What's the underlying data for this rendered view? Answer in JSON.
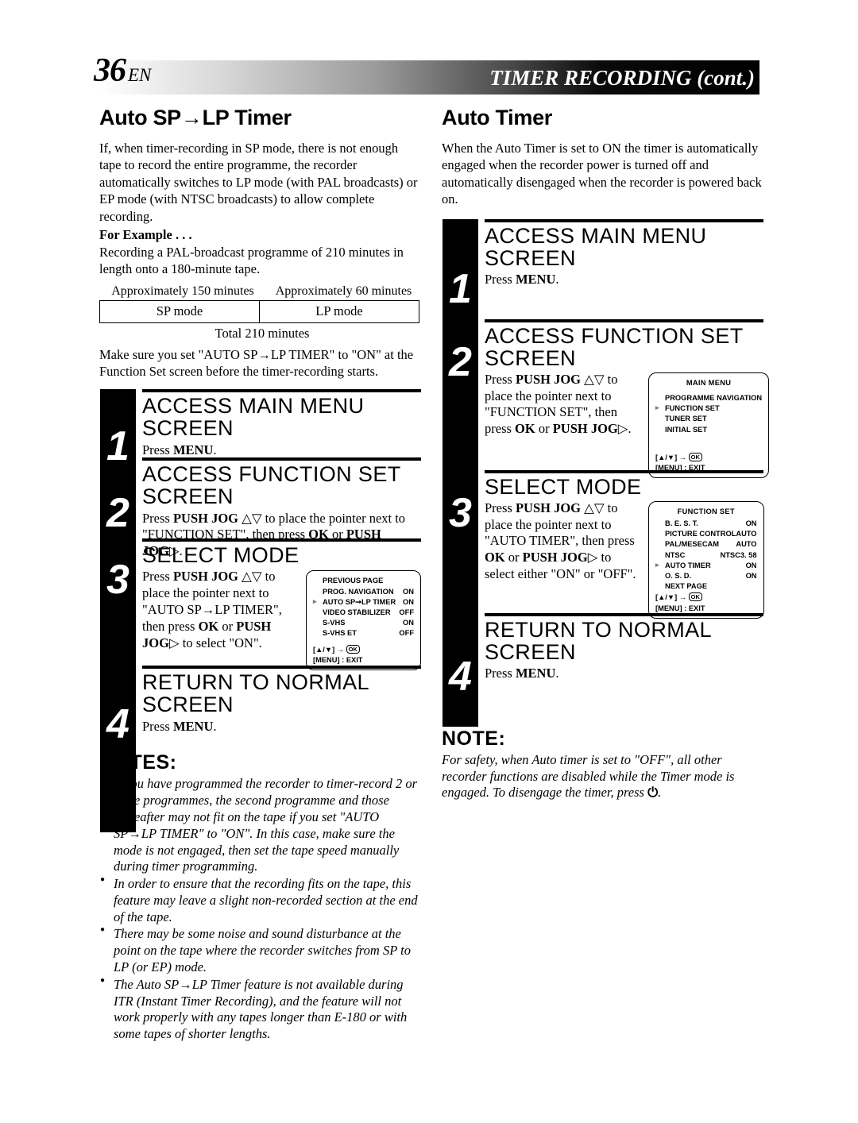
{
  "header": {
    "page_number": "36",
    "page_lang": "EN",
    "title": "TIMER RECORDING (cont.)"
  },
  "left_column": {
    "section_title": "Auto SP→LP Timer",
    "intro": "If, when timer-recording in SP mode, there is not enough tape to record the entire programme, the recorder automatically switches to LP mode (with PAL broadcasts) or EP mode (with NTSC broadcasts) to allow complete recording.",
    "for_example_label": "For Example . . .",
    "example_text": "Recording a PAL-broadcast programme of 210 minutes in length onto a 180-minute tape.",
    "example_table": {
      "labels": [
        "Approximately 150 minutes",
        "Approximately 60 minutes"
      ],
      "cells": [
        "SP mode",
        "LP mode"
      ],
      "total": "Total 210 minutes"
    },
    "make_sure_text": "Make sure you set \"AUTO SP→LP TIMER\" to \"ON\" at the Function Set screen before the timer-recording starts.",
    "steps": [
      {
        "number": "1",
        "heading": "ACCESS MAIN MENU SCREEN",
        "body_prefix": "Press ",
        "body_bold": "MENU",
        "body_suffix": "."
      },
      {
        "number": "2",
        "heading": "ACCESS FUNCTION SET SCREEN",
        "body_html": "Press <b>PUSH JOG</b> △▽ to place the pointer next to \"FUNCTION SET\", then press <b>OK</b> or <b>PUSH JOG</b>▷."
      },
      {
        "number": "3",
        "heading": "SELECT MODE",
        "body_html": "Press <b>PUSH JOG</b> △▽ to place the pointer next to \"AUTO SP→LP TIMER\", then press <b>OK</b> or <b>PUSH JOG</b>▷ to select \"ON\"."
      },
      {
        "number": "4",
        "heading": "RETURN TO NORMAL SCREEN",
        "body_prefix": "Press ",
        "body_bold": "MENU",
        "body_suffix": "."
      }
    ],
    "osd_function_set_page2": {
      "rows": [
        {
          "label": "PREVIOUS PAGE",
          "value": "",
          "pointer": false
        },
        {
          "label": "PROG. NAVIGATION",
          "value": "ON",
          "pointer": false
        },
        {
          "label": "AUTO SP➞LP TIMER",
          "value": "ON",
          "pointer": true
        },
        {
          "label": "VIDEO STABILIZER",
          "value": "OFF",
          "pointer": false
        },
        {
          "label": "S-VHS",
          "value": "ON",
          "pointer": false
        },
        {
          "label": "S-VHS ET",
          "value": "OFF",
          "pointer": false
        }
      ],
      "footer_nav": "[▲/▼] →",
      "footer_ok": "OK",
      "footer_exit": "[MENU] : EXIT"
    },
    "notes_heading": "NOTES:",
    "notes": [
      "If you have programmed the recorder to timer-record 2 or more programmes, the second programme and those thereafter may not fit on the tape if you set \"AUTO SP→LP TIMER\" to \"ON\". In this case, make sure the mode is not engaged, then set the tape speed manually during timer programming.",
      "In order to ensure that the recording fits on the tape, this feature may leave a slight non-recorded section at the end of the tape.",
      "There may be some noise and sound disturbance at the point on the tape where the recorder switches from SP to LP (or EP) mode.",
      "The Auto SP→LP Timer feature is not available during ITR (Instant Timer Recording), and the feature will not work properly with any tapes longer than E-180 or with some tapes of shorter lengths."
    ]
  },
  "right_column": {
    "section_title": "Auto Timer",
    "intro": "When the Auto Timer is set to ON the timer is automatically engaged when the recorder power is turned off and automatically disengaged when the recorder is powered back on.",
    "steps": [
      {
        "number": "1",
        "heading": "ACCESS MAIN MENU SCREEN",
        "body_prefix": "Press ",
        "body_bold": "MENU",
        "body_suffix": "."
      },
      {
        "number": "2",
        "heading": "ACCESS FUNCTION SET SCREEN",
        "body_html": "Press <b>PUSH JOG</b> △▽ to place the pointer next to \"FUNCTION SET\", then press <b>OK</b> or <b>PUSH JOG</b>▷."
      },
      {
        "number": "3",
        "heading": "SELECT MODE",
        "body_html": "Press <b>PUSH JOG</b> △▽ to place the pointer next to \"AUTO TIMER\", then press <b>OK</b> or <b>PUSH JOG</b>▷ to select either \"ON\" or \"OFF\"."
      },
      {
        "number": "4",
        "heading": "RETURN TO NORMAL SCREEN",
        "body_prefix": "Press ",
        "body_bold": "MENU",
        "body_suffix": "."
      }
    ],
    "osd_main_menu": {
      "title": "MAIN MENU",
      "rows": [
        {
          "label": "PROGRAMME NAVIGATION",
          "value": "",
          "pointer": false
        },
        {
          "label": "FUNCTION SET",
          "value": "",
          "pointer": true
        },
        {
          "label": "TUNER SET",
          "value": "",
          "pointer": false
        },
        {
          "label": "INITIAL SET",
          "value": "",
          "pointer": false
        }
      ],
      "footer_nav": "[▲/▼] →",
      "footer_ok": "OK",
      "footer_exit": "[MENU] : EXIT"
    },
    "osd_function_set": {
      "title": "FUNCTION SET",
      "rows": [
        {
          "label": "B. E. S. T.",
          "value": "ON",
          "pointer": false
        },
        {
          "label": "PICTURE CONTROL",
          "value": "AUTO",
          "pointer": false
        },
        {
          "label": "PAL/MESECAM",
          "value": "AUTO",
          "pointer": false
        },
        {
          "label": "NTSC",
          "value": "NTSC3. 58",
          "pointer": false
        },
        {
          "label": "AUTO TIMER",
          "value": "ON",
          "pointer": true
        },
        {
          "label": "O. S. D.",
          "value": "ON",
          "pointer": false
        },
        {
          "label": "NEXT PAGE",
          "value": "",
          "pointer": false
        }
      ],
      "footer_nav": "[▲/▼] →",
      "footer_ok": "OK",
      "footer_exit": "[MENU] : EXIT"
    },
    "note_heading": "NOTE:",
    "note_text_before": "For safety, when Auto timer is set to \"OFF\", all other recorder functions are disabled while the Timer mode is engaged. To disengage the timer, press ",
    "note_power_glyph": "⏻",
    "note_text_after": "."
  }
}
